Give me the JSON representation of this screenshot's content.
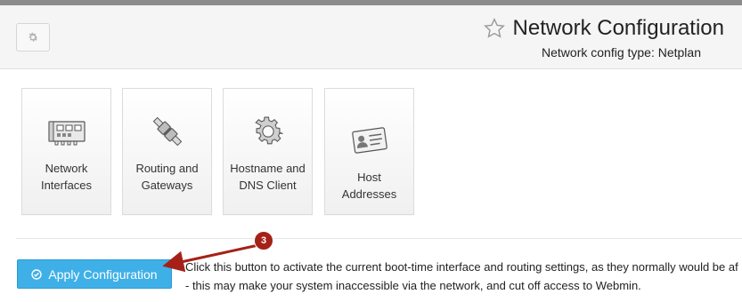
{
  "header": {
    "title": "Network Configuration",
    "subtitle": "Network config type: Netplan",
    "settings_icon": "gear-icon",
    "favorite_icon": "star-icon"
  },
  "tiles": [
    {
      "label_line1": "Network",
      "label_line2": "Interfaces",
      "icon": "network-card-icon"
    },
    {
      "label_line1": "Routing and",
      "label_line2": "Gateways",
      "icon": "cable-connector-icon"
    },
    {
      "label_line1": "Hostname and",
      "label_line2": "DNS Client",
      "icon": "gear-icon"
    },
    {
      "label_line1": "Host Addresses",
      "label_line2": "",
      "icon": "address-card-icon"
    }
  ],
  "apply": {
    "button_label": "Apply Configuration",
    "icon": "check-circle-icon",
    "description_line1": "Click this button to activate the current boot-time interface and routing settings, as they normally would be af",
    "description_line2": "- this may make your system inaccessible via the network, and cut off access to Webmin."
  },
  "annotation": {
    "badge": "3",
    "color": "#a52118"
  },
  "colors": {
    "accent_button": "#3fb0e7",
    "header_bg": "#f5f5f5",
    "top_strip": "#8c8c8c"
  }
}
